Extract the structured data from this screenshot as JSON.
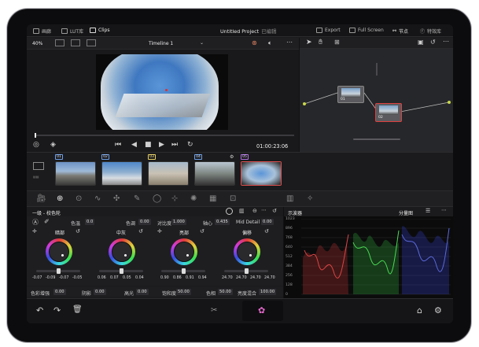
{
  "topbar": {
    "media_label": "画廊",
    "lut_label": "LUT库",
    "clips_label": "Clips",
    "project_title": "Untitled Project",
    "edit_status": "已编辑",
    "export_label": "Export",
    "fullscreen_label": "Full Screen",
    "nodes_label": "节点",
    "effects_label": "特效库"
  },
  "viewer": {
    "zoom": "40%",
    "timeline_name": "Timeline 1",
    "timecode": "01:00:23:06"
  },
  "nodes": [
    {
      "label": "01"
    },
    {
      "label": "02"
    }
  ],
  "clips": {
    "items": [
      {
        "num": "01"
      },
      {
        "num": "02"
      },
      {
        "num": "03"
      },
      {
        "num": "04"
      },
      {
        "num": "05"
      }
    ]
  },
  "color": {
    "panel_title": "一级 - 校色轮",
    "params_top": [
      {
        "label": "色温",
        "value": "0.0"
      },
      {
        "label": "色调",
        "value": "0.00"
      },
      {
        "label": "对比度",
        "value": "1.000"
      },
      {
        "label": "轴心",
        "value": "0.435"
      },
      {
        "label": "Mid Detail",
        "value": "0.00"
      }
    ],
    "wheels": [
      {
        "name": "暗部",
        "values": [
          "-0.07",
          "-0.09",
          "-0.07",
          "-0.05"
        ]
      },
      {
        "name": "中灰",
        "values": [
          "0.06",
          "0.07",
          "0.05",
          "0.04"
        ]
      },
      {
        "name": "亮部",
        "values": [
          "0.90",
          "0.86",
          "0.91",
          "0.94"
        ]
      },
      {
        "name": "偏移",
        "values": [
          "24.70",
          "24.70",
          "24.70",
          "24.70"
        ]
      }
    ],
    "params_bottom": [
      {
        "label": "色彩增强",
        "value": "0.00"
      },
      {
        "label": "阴影",
        "value": "0.00"
      },
      {
        "label": "高光",
        "value": "0.00"
      },
      {
        "label": "饱和度",
        "value": "50.00"
      },
      {
        "label": "色相",
        "value": "50.00"
      },
      {
        "label": "亮度混合",
        "value": "100.00"
      }
    ]
  },
  "scope": {
    "title": "示波器",
    "mode": "分量图",
    "scale": [
      "1023",
      "896",
      "768",
      "640",
      "512",
      "384",
      "256",
      "128",
      "0"
    ]
  }
}
